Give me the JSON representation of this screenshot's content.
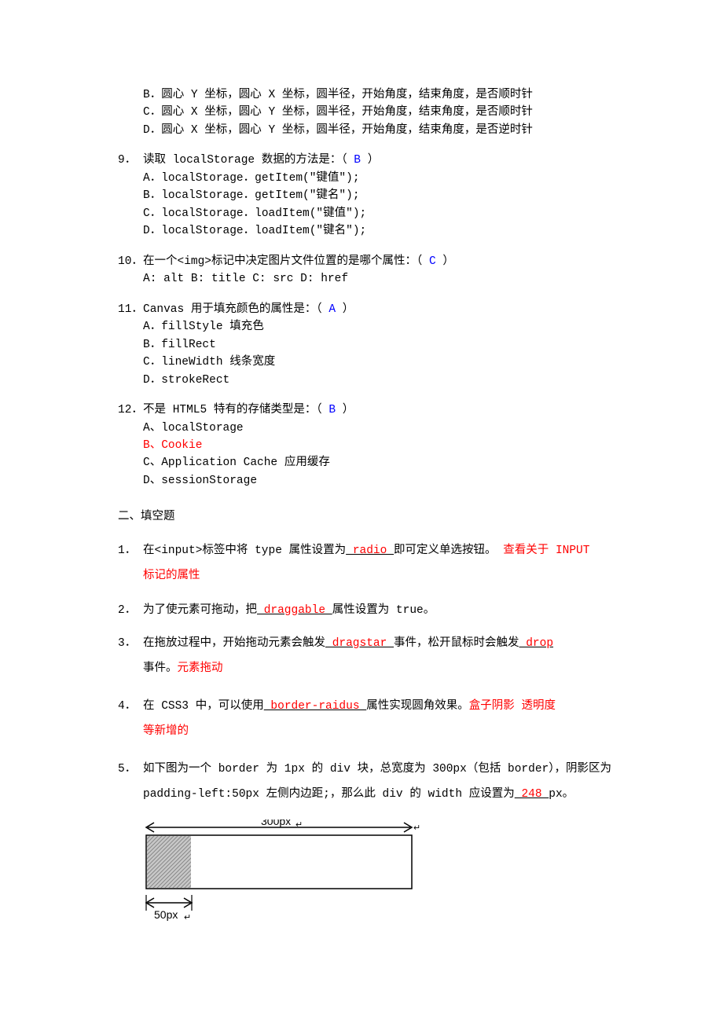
{
  "q8": {
    "opts": {
      "b": "B．圆心 Y 坐标，圆心 X 坐标，圆半径，开始角度，结束角度，是否顺时针",
      "c": "C．圆心 X 坐标，圆心 Y 坐标，圆半径，开始角度，结束角度，是否顺时针",
      "d": "D．圆心 X 坐标，圆心 Y 坐标，圆半径，开始角度，结束角度，是否逆时针"
    }
  },
  "q9": {
    "num": "9．",
    "q_before": "读取 localStorage 数据的方法是：（",
    "ans": "  B  ",
    "q_after": "）",
    "opts": {
      "a": "A．localStorage．getItem(\"键值\");",
      "b": "B．localStorage．getItem(\"键名\");",
      "c": "C．localStorage．loadItem(\"键值\");",
      "d": "D．localStorage．loadItem(\"键名\");"
    }
  },
  "q10": {
    "num": "10．",
    "q_before": "在一个<img>标记中决定图片文件位置的是哪个属性：（",
    "ans": " C ",
    "q_after": "）",
    "opts": {
      "a": "A: alt B: title C: src D: href"
    }
  },
  "q11": {
    "num": "11．",
    "q_before": "Canvas 用于填充颜色的属性是：（",
    "ans": "  A  ",
    "q_after": "）",
    "opts": {
      "a": "A．fillStyle 填充色",
      "b": "B．fillRect",
      "c": "C．lineWidth 线条宽度",
      "d": "D．strokeRect"
    }
  },
  "q12": {
    "num": "12．",
    "q_before": "不是 HTML5 特有的存储类型是：（",
    "ans": "  B  ",
    "q_after": "）",
    "opts": {
      "a": "A、localStorage",
      "b": "B、Cookie",
      "c": "C、Application Cache 应用缓存",
      "d": "D、sessionStorage"
    }
  },
  "section2": "二、填空题",
  "f1": {
    "num": "1．",
    "t1": "在<input>标签中将 type 属性设置为",
    "ans": "  radio        ",
    "t2": "即可定义单选按钮。 ",
    "note1": "查看关于 INPUT",
    "note2": "标记的属性"
  },
  "f2": {
    "num": "2．",
    "t1": "为了使元素可拖动，把",
    "ans": " draggable       ",
    "t2": "属性设置为 true。"
  },
  "f3": {
    "num": "3．",
    "t1": "在拖放过程中，开始拖动元素会触发",
    "ans1": "  dragstar       ",
    "t2": "事件，松开鼠标时会触发",
    "ans2": "  drop   ",
    "t3": "事件。",
    "note": "元素拖动"
  },
  "f4": {
    "num": "4．",
    "t1": "在 CSS3 中，可以使用",
    "ans": "  border-raidus        ",
    "t2": "属性实现圆角效果。",
    "note1": "盒子阴影 透明度",
    "note2": "等新增的"
  },
  "f5": {
    "num": "5．",
    "t1": "如下图为一个 border 为 1px 的 div 块，总宽度为 300px（包括 border），阴影区为",
    "t2": "padding-left:50px 左侧内边距;，那么此 div 的 width 应设置为",
    "ans": "  248        ",
    "t3": " px。"
  },
  "diagram": {
    "label_300": "300px",
    "label_50": "50px"
  }
}
